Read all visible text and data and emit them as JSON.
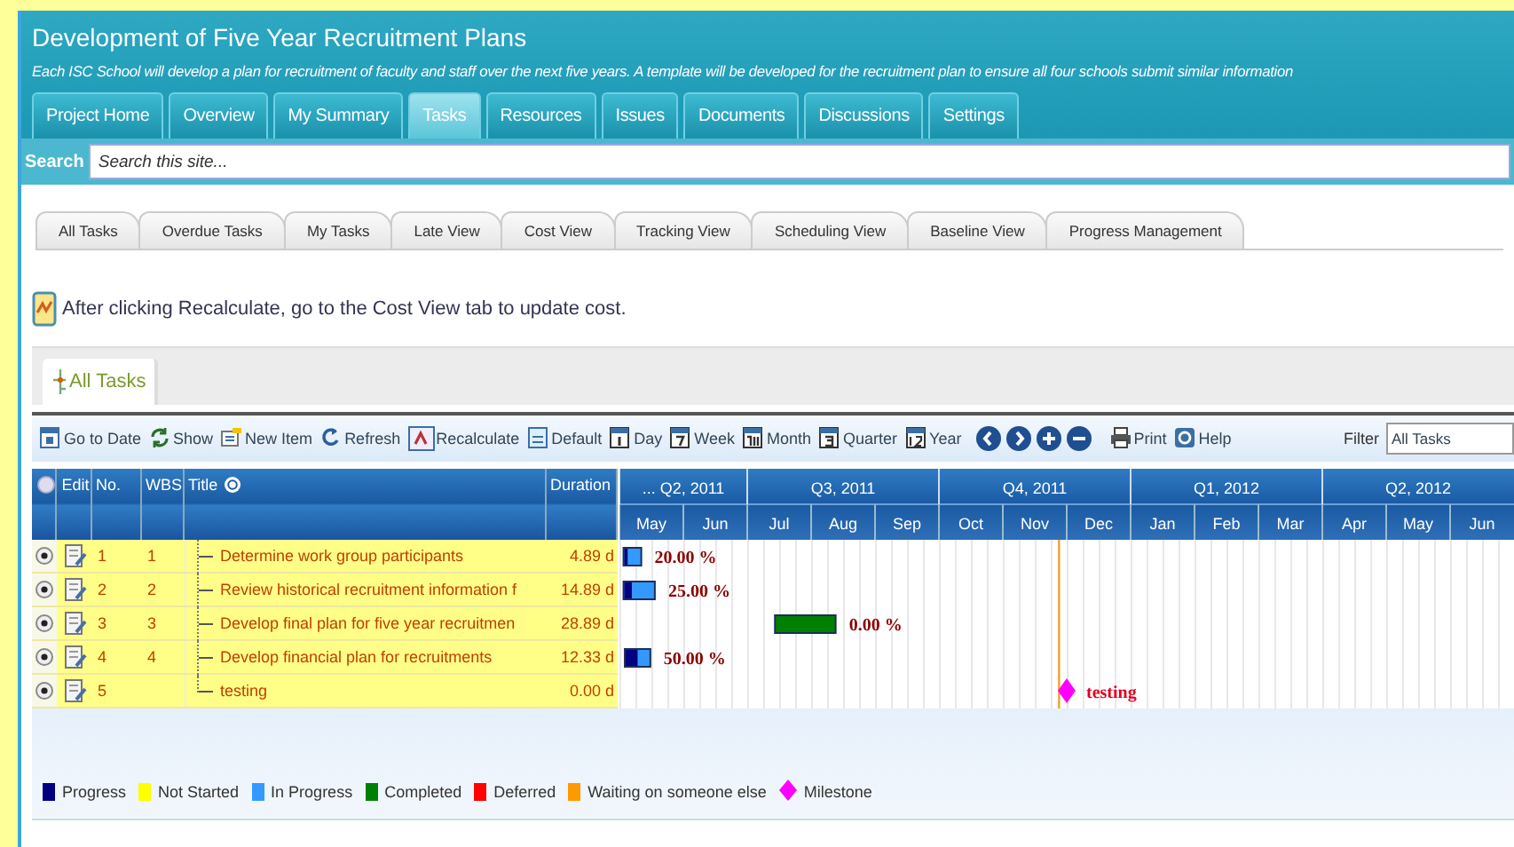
{
  "project": {
    "title": "Development of Five Year Recruitment Plans",
    "description": "Each ISC School will develop a plan for recruitment of faculty and staff over the next five years.  A template will be developed for the recruitment plan to ensure all four schools submit similar information"
  },
  "nav_tabs": [
    {
      "label": "Project Home",
      "selected": false
    },
    {
      "label": "Overview",
      "selected": false
    },
    {
      "label": "My Summary",
      "selected": false
    },
    {
      "label": "Tasks",
      "selected": true
    },
    {
      "label": "Resources",
      "selected": false
    },
    {
      "label": "Issues",
      "selected": false
    },
    {
      "label": "Documents",
      "selected": false
    },
    {
      "label": "Discussions",
      "selected": false
    },
    {
      "label": "Settings",
      "selected": false
    }
  ],
  "search": {
    "label": "Search",
    "placeholder": "Search this site..."
  },
  "view_tabs": [
    "All Tasks",
    "Overdue Tasks",
    "My Tasks",
    "Late View",
    "Cost View",
    "Tracking View",
    "Scheduling View",
    "Baseline View",
    "Progress Management"
  ],
  "notice": "After clicking Recalculate, go to the Cost View tab to update cost.",
  "list_tab": {
    "label": "All Tasks"
  },
  "toolbar": [
    "Go to Date",
    "Show",
    "New Item",
    "Refresh",
    "Recalculate",
    "Default",
    "Day",
    "Week",
    "Month",
    "Quarter",
    "Year",
    "Print",
    "Help"
  ],
  "filter": {
    "label": "Filter",
    "value": "All Tasks"
  },
  "grid": {
    "columns": [
      "Edit",
      "No.",
      "WBS",
      "Title",
      "Duration"
    ]
  },
  "tasks": [
    {
      "no": "1",
      "wbs": "1",
      "title": "Determine work group participants",
      "duration": "4.89 d",
      "kind": "bar",
      "completed": false,
      "level": 0.2,
      "bar_label": "20.00 %"
    },
    {
      "no": "2",
      "wbs": "2",
      "title": "Review historical recruitment information f",
      "duration": "14.89 d",
      "kind": "bar",
      "completed": false,
      "level": 0.25,
      "bar_label": "25.00 %"
    },
    {
      "no": "3",
      "wbs": "3",
      "title": "Develop final plan for five year recruitmen",
      "duration": "28.89 d",
      "kind": "bar",
      "completed": true,
      "bar_label": "0.00 %"
    },
    {
      "no": "4",
      "wbs": "4",
      "title": "Develop financial plan for recruitments",
      "duration": "12.33 d",
      "kind": "bar",
      "completed": false,
      "level": 0.5,
      "bar_label": "50.00 %"
    },
    {
      "no": "5",
      "title": "testing",
      "duration": "0.00 d",
      "kind": "milestone",
      "bar_label": "testing"
    }
  ],
  "gantt": {
    "quarters": [
      {
        "label": "... Q2, 2011",
        "months": [
          "May",
          "Jun"
        ]
      },
      {
        "label": "Q3, 2011",
        "months": [
          "Jul",
          "Aug",
          "Sep"
        ]
      },
      {
        "label": "Q4, 2011",
        "months": [
          "Oct",
          "Nov",
          "Dec"
        ]
      },
      {
        "label": "Q1, 2012",
        "months": [
          "Jan",
          "Feb",
          "Mar"
        ]
      },
      {
        "label": "Q2, 2012",
        "months": [
          "Apr",
          "May",
          "Jun"
        ]
      }
    ]
  },
  "legend": [
    {
      "label": "Progress",
      "color": "#000080",
      "kind": "square"
    },
    {
      "label": "Not Started",
      "color": "#ffff00",
      "kind": "square"
    },
    {
      "label": "In Progress",
      "color": "#3399ff",
      "kind": "square"
    },
    {
      "label": "Completed",
      "color": "#008000",
      "kind": "square"
    },
    {
      "label": "Deferred",
      "color": "#ff0000",
      "kind": "square"
    },
    {
      "label": "Waiting on someone else",
      "color": "#ff9900",
      "kind": "square"
    },
    {
      "label": "Milestone",
      "color": "#ff00ff",
      "kind": "diamond"
    }
  ]
}
